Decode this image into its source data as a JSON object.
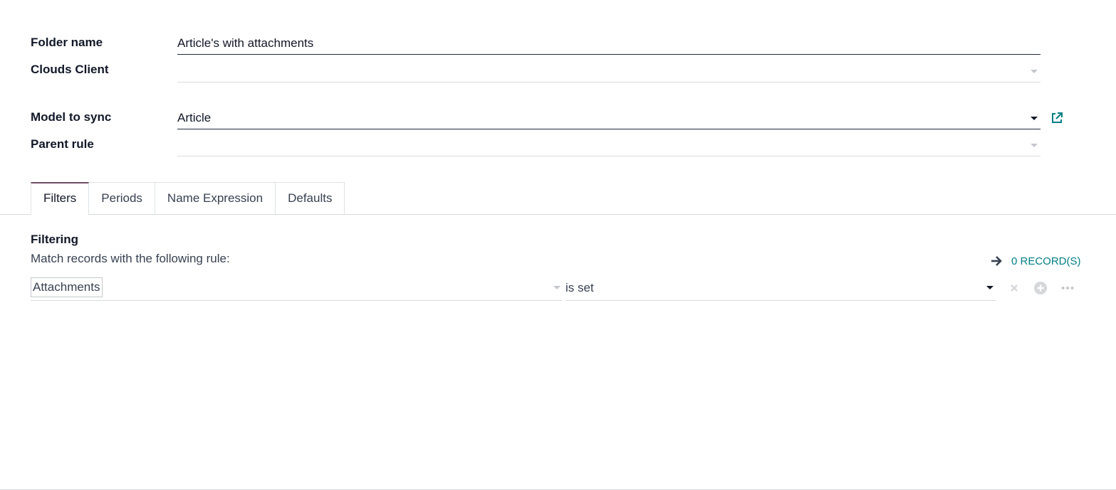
{
  "form": {
    "folder_name": {
      "label": "Folder name",
      "value": "Article's with attachments"
    },
    "clouds_client": {
      "label": "Clouds Client",
      "value": ""
    },
    "model_to_sync": {
      "label": "Model to sync",
      "value": "Article"
    },
    "parent_rule": {
      "label": "Parent rule",
      "value": ""
    }
  },
  "tabs": [
    {
      "label": "Filters",
      "active": true
    },
    {
      "label": "Periods",
      "active": false
    },
    {
      "label": "Name Expression",
      "active": false
    },
    {
      "label": "Defaults",
      "active": false
    }
  ],
  "filters": {
    "title": "Filtering",
    "description": "Match records with the following rule:",
    "records_label": "0 RECORD(S)",
    "rule": {
      "field": "Attachments",
      "operator": "is set"
    }
  },
  "icons": {
    "external_link": "external-link-icon",
    "records_arrow": "arrow-right-icon",
    "remove": "close-icon",
    "add": "plus-circle-icon",
    "more": "ellipsis-icon"
  },
  "colors": {
    "accent": "#714b67",
    "link": "#017e84",
    "text": "#111827"
  }
}
